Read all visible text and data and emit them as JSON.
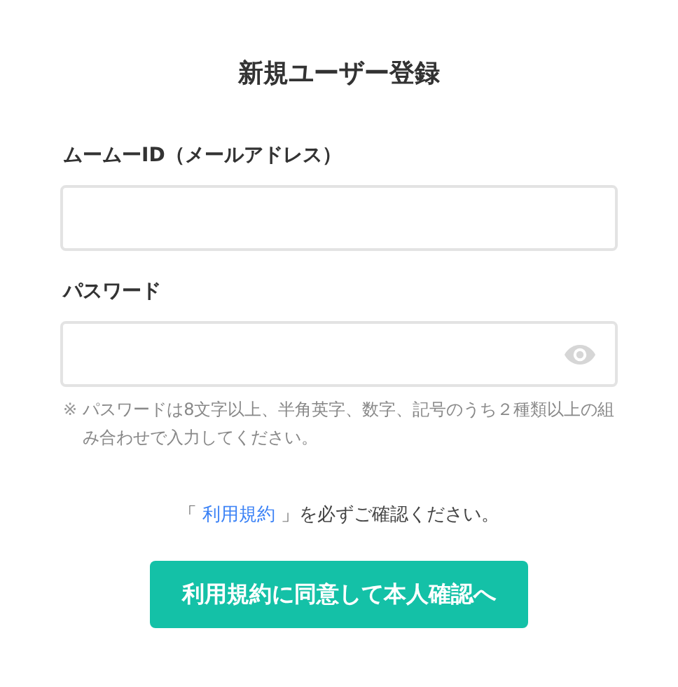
{
  "title": "新規ユーザー登録",
  "fields": [
    {
      "kind": "text",
      "label": "ムームーID（メールアドレス）"
    },
    {
      "kind": "password",
      "label": "パスワード"
    }
  ],
  "password_note": {
    "mark": "※",
    "text": "パスワードは8文字以上、半角英字、数字、記号のうち２種類以上の組み合わせで入力してください。"
  },
  "terms": {
    "before": "「",
    "link": "利用規約",
    "after": "」を必ずご確認ください。"
  },
  "submit_button": "利用規約に同意して本人確認へ"
}
